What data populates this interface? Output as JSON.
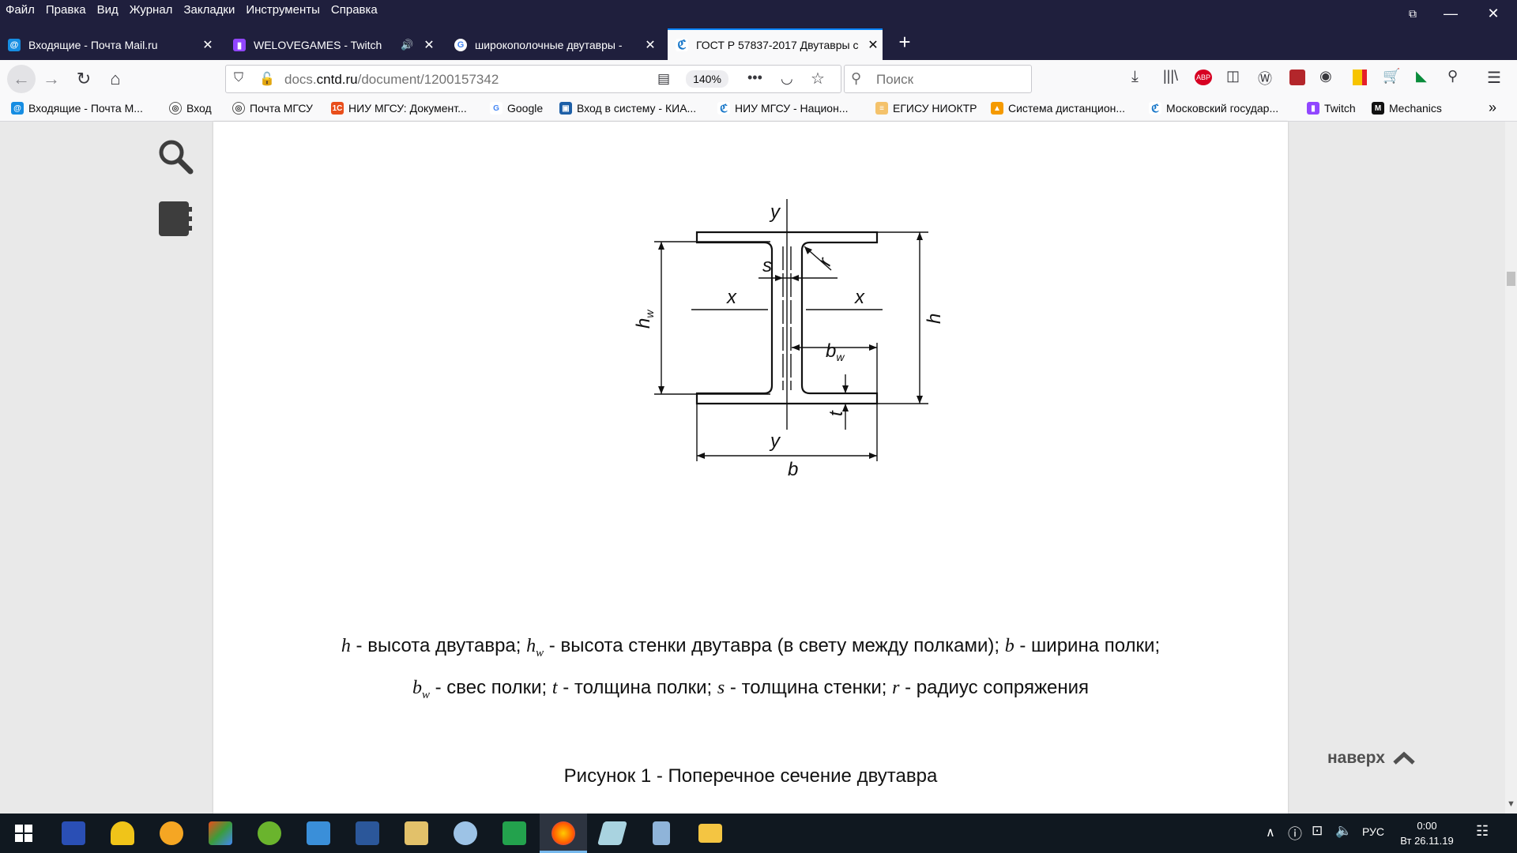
{
  "menu": [
    "Файл",
    "Правка",
    "Вид",
    "Журнал",
    "Закладки",
    "Инструменты",
    "Справка"
  ],
  "window_controls": {
    "minimize": "—",
    "restore": "❐",
    "close": "✕"
  },
  "tabs": [
    {
      "label": "Входящие - Почта Mail.ru",
      "icon": "mail-icon"
    },
    {
      "label": "WELOVEGAMES - Twitch",
      "icon": "twitch-icon",
      "audio": "🔊"
    },
    {
      "label": "широкополочные двутавры -",
      "icon": "google-icon"
    },
    {
      "label": "ГОСТ Р 57837-2017 Двутавры с",
      "icon": "cntd-icon"
    }
  ],
  "new_tab": "+",
  "url": {
    "prefix": "docs.",
    "domain": "cntd.ru",
    "path": "/document/1200157342"
  },
  "zoom": "140%",
  "search_placeholder": "Поиск",
  "bookmarks": [
    "Входящие - Почта М...",
    "Вход",
    "Почта МГСУ",
    "НИУ МГСУ: Документ...",
    "Google",
    "Вход в систему - КИА...",
    "НИУ МГСУ - Национ...",
    "ЕГИСУ НИОКТР",
    "Система дистанцион...",
    "Московский государ...",
    "Twitch",
    "Mechanics"
  ],
  "diagram": {
    "labels": {
      "y_top": "y",
      "y_bottom": "y",
      "x_left": "x",
      "x_right": "x",
      "s": "s",
      "r": "r",
      "t": "t",
      "h": "h",
      "b": "b",
      "hw": "h",
      "hw_sub": "w",
      "bw": "b",
      "bw_sub": "w"
    }
  },
  "legend": {
    "h": "h",
    "line1_a": " - высота двутавра; ",
    "hw": "h",
    "w1": "w",
    "line1_b": " - высота стенки двутавра (в свету между полками); ",
    "b": "b",
    "line1_c": " - ширина полки;",
    "bw": "b",
    "w2": "w",
    "line2_a": " - свес полки; ",
    "t": "t",
    "line2_b": " - толщина полки; ",
    "s": "s",
    "line2_c": " - толщина стенки; ",
    "r": "r",
    "line2_d": " - радиус сопряжения"
  },
  "figure_caption": "Рисунок 1 - Поперечное сечение двутавра",
  "back_to_top": "наверх",
  "tray": {
    "lang": "РУС",
    "time": "0:00",
    "date": "Вт 26.11.19"
  }
}
